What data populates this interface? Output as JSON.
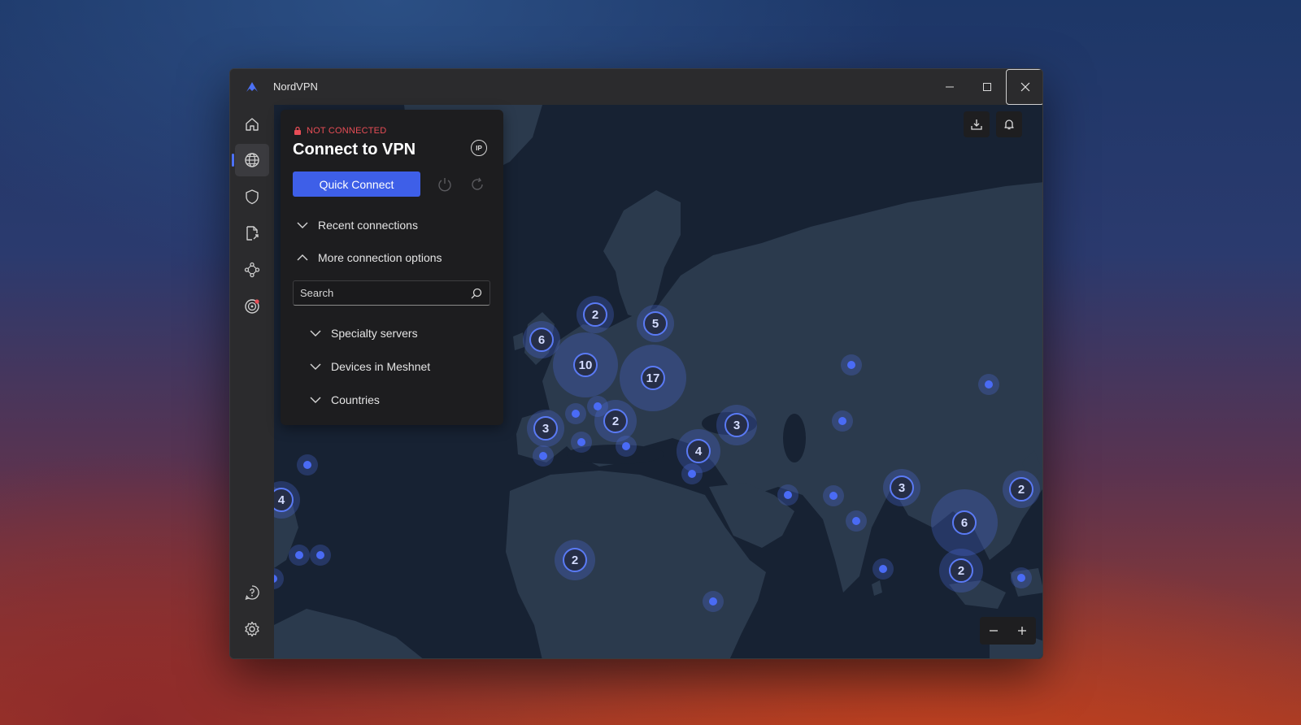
{
  "window": {
    "title": "NordVPN"
  },
  "panel": {
    "status": "NOT CONNECTED",
    "title": "Connect to VPN",
    "ip_label": "IP",
    "quick_connect": "Quick Connect",
    "recent_connections": "Recent connections",
    "more_options": "More connection options",
    "search_placeholder": "Search",
    "options": [
      "Specialty servers",
      "Devices in Meshnet",
      "Countries"
    ]
  },
  "map": {
    "clusters": [
      "2",
      "5",
      "6",
      "10",
      "17",
      "3",
      "2",
      "4",
      "3",
      "3",
      "6",
      "2",
      "2",
      "4",
      "2"
    ]
  },
  "colors": {
    "accent": "#3e5fe8",
    "status_red": "#e84d56",
    "marker": "#4a6bf5"
  },
  "icons": [
    "nordvpn-logo-icon",
    "home-icon",
    "globe-icon",
    "shield-icon",
    "file-share-icon",
    "meshnet-icon",
    "dark-web-monitor-icon",
    "help-icon",
    "settings-icon"
  ]
}
